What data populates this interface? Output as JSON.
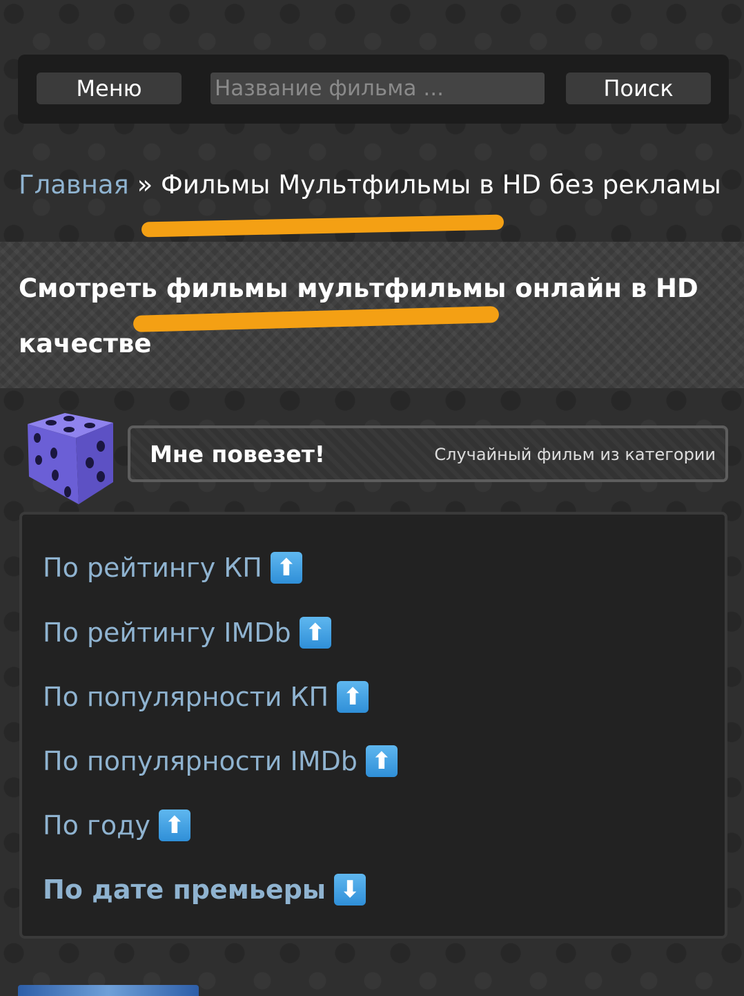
{
  "header": {
    "menu_label": "Меню",
    "search_placeholder": "Название фильма ...",
    "search_label": "Поиск"
  },
  "breadcrumb": {
    "home": "Главная",
    "separator": " » ",
    "current": "Фильмы Мультфильмы в HD без рекламы"
  },
  "page_title": "Смотреть фильмы мультфильмы онлайн в HD качестве",
  "lucky": {
    "title": "Мне повезет!",
    "subtitle": "Случайный фильм из категории"
  },
  "sort_options": [
    {
      "label": "По рейтингу КП",
      "arrow": "⬆"
    },
    {
      "label": "По рейтингу IMDb",
      "arrow": "⬆"
    },
    {
      "label": "По популярности КП",
      "arrow": "⬆"
    },
    {
      "label": "По популярности IMDb",
      "arrow": "⬆"
    },
    {
      "label": "По году",
      "arrow": "⬆"
    },
    {
      "label": "По дате премьеры",
      "arrow": "⬇"
    }
  ],
  "colors": {
    "link": "#8fb3d0",
    "highlight": "#f4a014",
    "dice": "#7b6ee0"
  }
}
